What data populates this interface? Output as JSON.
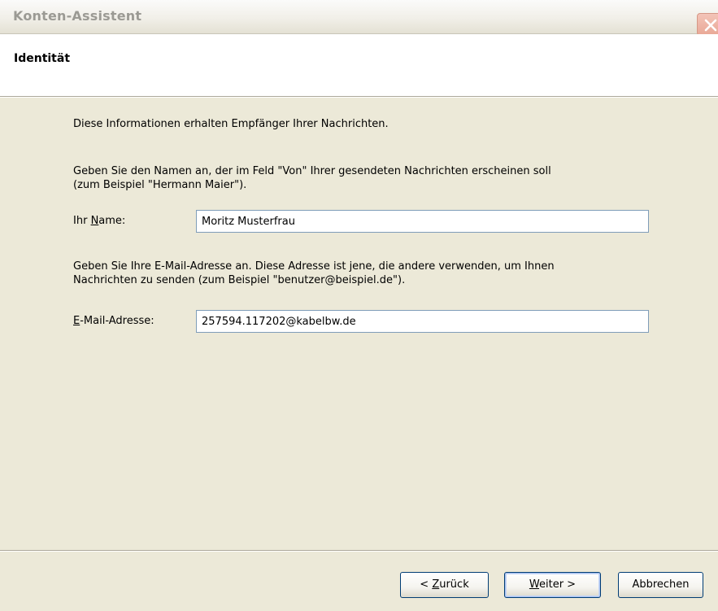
{
  "window": {
    "title": "Konten-Assistent",
    "close_icon": "close-icon"
  },
  "header": {
    "title": "Identität"
  },
  "content": {
    "intro": "Diese Informationen erhalten Empfänger Ihrer Nachrichten.",
    "name_help_line1": "Geben Sie den Namen an, der im Feld \"Von\" Ihrer gesendeten Nachrichten erscheinen soll",
    "name_help_line2": "(zum Beispiel \"Hermann Maier\").",
    "name_label_prefix": "Ihr ",
    "name_label_accel": "N",
    "name_label_rest": "ame:",
    "name_value": "Moritz Musterfrau",
    "email_help_line1": "Geben Sie Ihre E-Mail-Adresse an. Diese Adresse ist jene, die andere verwenden, um Ihnen",
    "email_help_line2": "Nachrichten zu senden (zum Beispiel \"benutzer@beispiel.de\").",
    "email_label_accel": "E",
    "email_label_rest": "-Mail-Adresse:",
    "email_value": "257594.117202@kabelbw.de"
  },
  "buttons": {
    "back_prefix": "< ",
    "back_accel": "Z",
    "back_rest": "urück",
    "next_accel": "W",
    "next_rest": "eiter >",
    "cancel": "Abbrechen"
  }
}
